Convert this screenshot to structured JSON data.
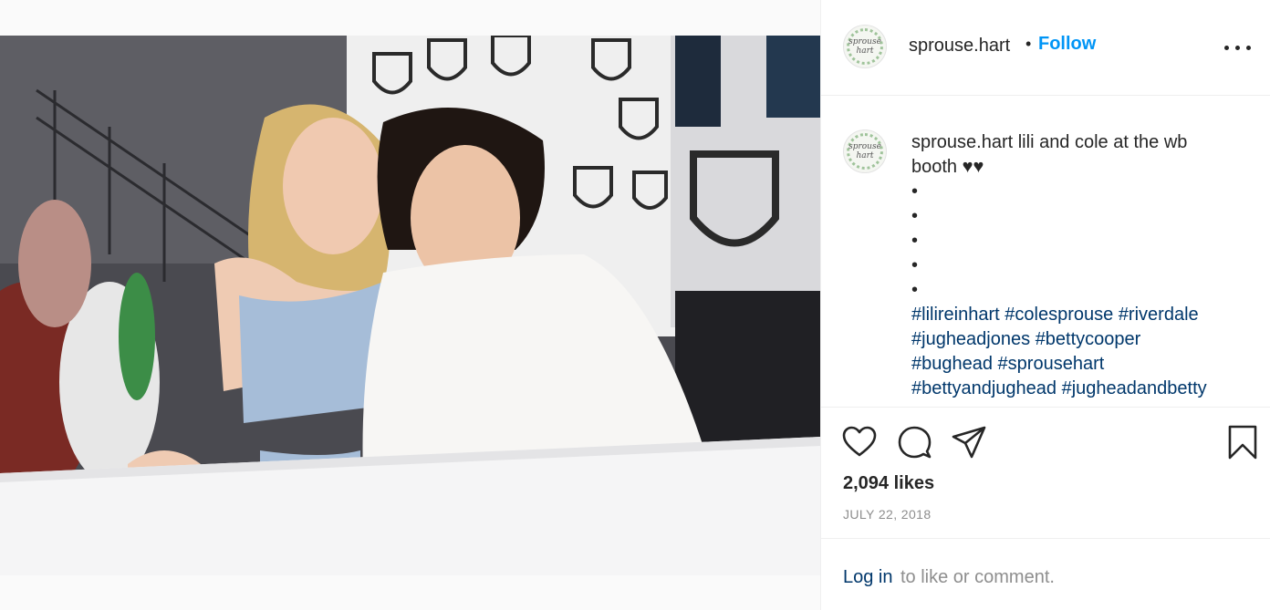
{
  "post": {
    "author": "sprouse.hart",
    "follow_label": "Follow",
    "separator": "•",
    "avatar_text": "sprouse hart",
    "caption_first": "lili and cole at the wb",
    "caption_second": "booth ♥♥",
    "bullets": [
      "•",
      "•",
      "•",
      "•",
      "•"
    ],
    "hashtags": [
      [
        "#lilireinhart",
        "#colesprouse",
        "#riverdale"
      ],
      [
        "#jugheadjones",
        "#bettycooper"
      ],
      [
        "#bughead",
        "#sprousehart"
      ],
      [
        "#bettyandjughead",
        "#jugheadandbetty"
      ]
    ],
    "likes": "2,094 likes",
    "date": "JULY 22, 2018"
  },
  "comment": {
    "login_label": "Log in",
    "prompt": "to like or comment."
  },
  "icons": [
    "heart-icon",
    "comment-icon",
    "share-icon",
    "bookmark-icon",
    "more-icon"
  ],
  "colors": {
    "follow": "#0095f6",
    "hashtag": "#00376b",
    "muted": "#8e8e8e",
    "text": "#262626"
  }
}
